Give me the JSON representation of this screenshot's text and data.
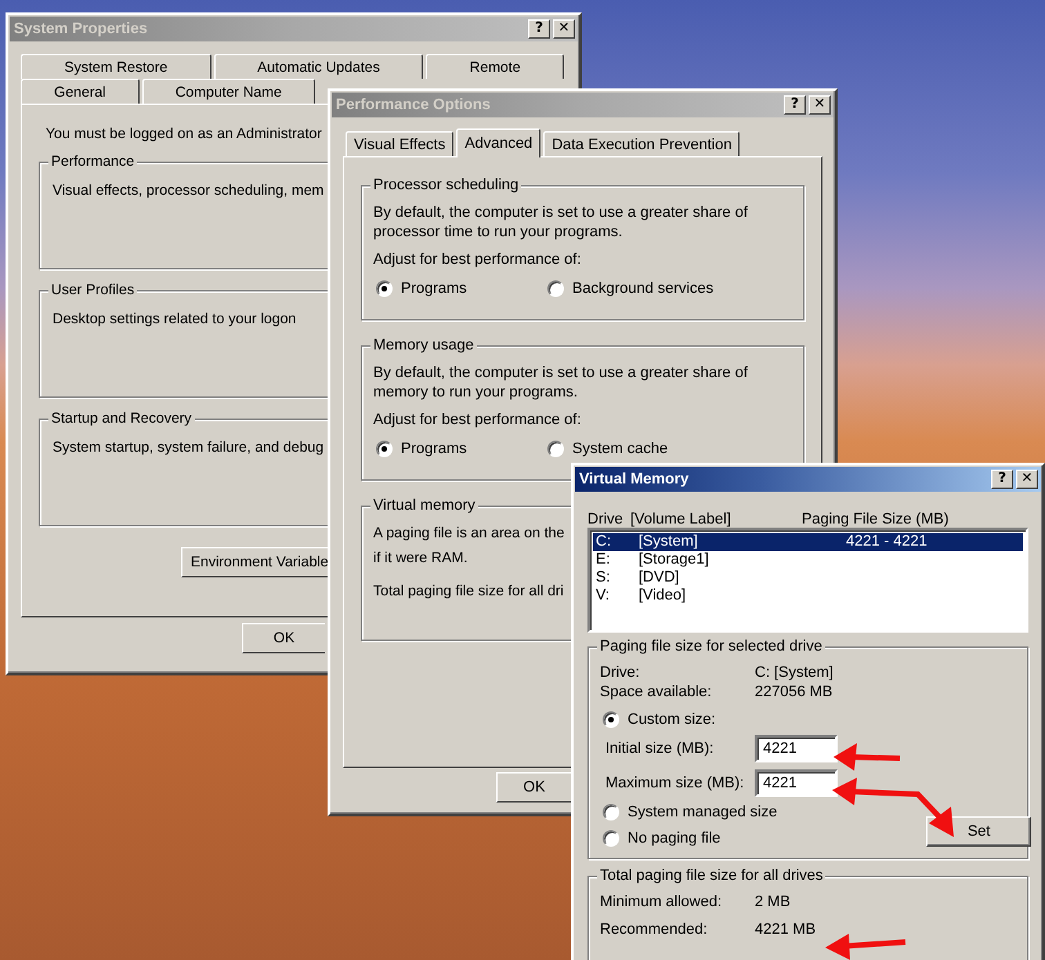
{
  "system_properties": {
    "title": "System Properties",
    "title_buttons": [
      "?",
      "✕"
    ],
    "tab_rows": [
      [
        {
          "label": "System Restore",
          "selected": false
        },
        {
          "label": "Automatic Updates",
          "selected": false
        },
        {
          "label": "Remote",
          "selected": false
        }
      ],
      [
        {
          "label": "General",
          "selected": false
        },
        {
          "label": "Computer Name",
          "selected": false
        }
      ]
    ],
    "notice": "You must be logged on as an Administrator",
    "groups": [
      {
        "title": "Performance",
        "text": "Visual effects, processor scheduling, mem"
      },
      {
        "title": "User Profiles",
        "text": "Desktop settings related to your logon"
      },
      {
        "title": "Startup and Recovery",
        "text": "System startup, system failure, and debug"
      }
    ],
    "panel_button": "Environment Variable",
    "ok_button": "OK"
  },
  "performance_options": {
    "title": "Performance Options",
    "title_buttons": [
      "?",
      "✕"
    ],
    "tabs": [
      {
        "label": "Visual Effects",
        "selected": false
      },
      {
        "label": "Advanced",
        "selected": true
      },
      {
        "label": "Data Execution Prevention",
        "selected": false
      }
    ],
    "groups": [
      {
        "kind": "choice",
        "title": "Processor scheduling",
        "text": "By default, the computer is set to use a greater share of processor time to run your programs.",
        "prompt": "Adjust for best performance of:",
        "options": [
          {
            "label": "Programs",
            "selected": true
          },
          {
            "label": "Background services",
            "selected": false
          }
        ]
      },
      {
        "kind": "choice",
        "title": "Memory usage",
        "text": "By default, the computer is set to use a greater share of memory to run your programs.",
        "prompt": "Adjust for best performance of:",
        "options": [
          {
            "label": "Programs",
            "selected": true
          },
          {
            "label": "System cache",
            "selected": false
          }
        ]
      },
      {
        "kind": "info",
        "title": "Virtual memory",
        "lines": [
          "A paging file is an area on the",
          "if it were RAM."
        ],
        "prompt": "Total paging file size for all dri"
      }
    ],
    "ok_button": "OK"
  },
  "virtual_memory": {
    "title": "Virtual Memory",
    "title_buttons": [
      "?",
      "✕"
    ],
    "columns": [
      "Drive",
      "[Volume Label]",
      "Paging File Size (MB)"
    ],
    "drives": [
      {
        "drive": "C:",
        "label": "[System]",
        "size": "4221 - 4221",
        "selected": true
      },
      {
        "drive": "E:",
        "label": "[Storage1]",
        "selected": false
      },
      {
        "drive": "S:",
        "label": "[DVD]",
        "selected": false
      },
      {
        "drive": "V:",
        "label": "[Video]",
        "selected": false
      }
    ],
    "selected_drive": {
      "title": "Paging file size for selected drive",
      "info": [
        {
          "label": "Drive:",
          "value": "C:  [System]"
        },
        {
          "label": "Space available:",
          "value": "227056 MB"
        }
      ],
      "custom": {
        "label": "Custom size:",
        "selected": true
      },
      "fields": [
        {
          "label": "Initial size (MB):",
          "value": "4221"
        },
        {
          "label": "Maximum size (MB):",
          "value": "4221"
        }
      ],
      "options": [
        {
          "label": "System managed size",
          "selected": false
        },
        {
          "label": "No paging file",
          "selected": false
        }
      ],
      "set_button": "Set"
    },
    "totals": {
      "title": "Total paging file size for all drives",
      "rows": [
        {
          "label": "Minimum allowed:",
          "value": "2 MB"
        },
        {
          "label": "Recommended:",
          "value": "4221 MB"
        }
      ]
    }
  }
}
